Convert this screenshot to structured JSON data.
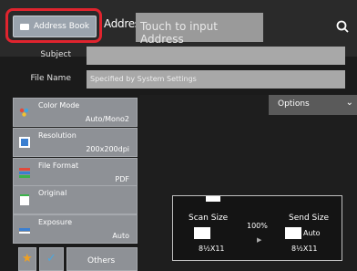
{
  "header": {
    "address_book_label": "Address Book",
    "address_label": "Address",
    "address_placeholder": "Touch to input Address"
  },
  "fields": {
    "subject_label": "Subject",
    "subject_value": "",
    "file_name_label": "File Name",
    "file_name_placeholder": "Specified by System Settings"
  },
  "settings": [
    {
      "title": "Color Mode",
      "value": "Auto/Mono2",
      "icon": "color-mode-icon"
    },
    {
      "title": "Resolution",
      "value": "200x200dpi",
      "icon": "resolution-icon"
    },
    {
      "title": "File Format",
      "value": "PDF",
      "icon": "file-format-icon"
    },
    {
      "title": "Original",
      "value": "",
      "icon": "original-icon"
    },
    {
      "title": "Exposure",
      "value": "Auto",
      "icon": "exposure-icon"
    }
  ],
  "bottom": {
    "others_label": "Others"
  },
  "options_label": "Options",
  "preview": {
    "scan_size_label": "Scan Size",
    "scan_size_value": "8½X11",
    "ratio": "100%",
    "send_size_label": "Send Size",
    "send_size_mode": "Auto",
    "send_size_value": "8½X11"
  },
  "colors": {
    "highlight": "#e0242e",
    "button": "#8e9196",
    "background": "#1b1b1b"
  }
}
